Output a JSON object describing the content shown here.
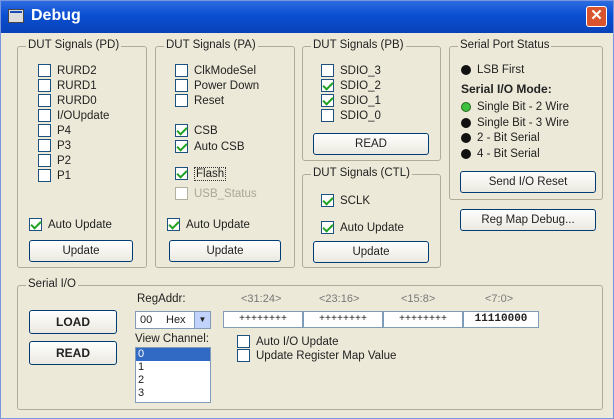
{
  "window": {
    "title": "Debug",
    "close_glyph": "✕"
  },
  "pd": {
    "title": "DUT Signals (PD)",
    "items": [
      {
        "label": "RURD2",
        "checked": false
      },
      {
        "label": "RURD1",
        "checked": false
      },
      {
        "label": "RURD0",
        "checked": false
      },
      {
        "label": "I/OUpdate",
        "checked": false
      },
      {
        "label": "P4",
        "checked": false
      },
      {
        "label": "P3",
        "checked": false
      },
      {
        "label": "P2",
        "checked": false
      },
      {
        "label": "P1",
        "checked": false
      }
    ],
    "auto_update": {
      "label": "Auto Update",
      "checked": true
    },
    "update_label": "Update"
  },
  "pa": {
    "title": "DUT Signals (PA)",
    "items": [
      {
        "label": "ClkModeSel",
        "checked": false
      },
      {
        "label": "Power Down",
        "checked": false
      },
      {
        "label": "Reset",
        "checked": false
      },
      {
        "label": "CSB",
        "checked": true
      },
      {
        "label": "Auto CSB",
        "checked": true
      },
      {
        "label": "Flash",
        "checked": true
      },
      {
        "label": "USB_Status",
        "checked": false,
        "disabled": true
      }
    ],
    "auto_update": {
      "label": "Auto Update",
      "checked": true
    },
    "update_label": "Update"
  },
  "pb": {
    "title": "DUT Signals (PB)",
    "items": [
      {
        "label": "SDIO_3",
        "checked": false
      },
      {
        "label": "SDIO_2",
        "checked": true
      },
      {
        "label": "SDIO_1",
        "checked": true
      },
      {
        "label": "SDIO_0",
        "checked": false
      }
    ],
    "read_label": "READ"
  },
  "ctl": {
    "title": "DUT Signals (CTL)",
    "sclk": {
      "label": "SCLK",
      "checked": true
    },
    "auto_update": {
      "label": "Auto Update",
      "checked": true
    },
    "update_label": "Update"
  },
  "sps": {
    "title": "Serial Port Status",
    "lsb_first": "LSB First",
    "mode_heading": "Serial I/O Mode:",
    "modes": [
      {
        "label": "Single Bit - 2 Wire",
        "selected": true
      },
      {
        "label": "Single Bit - 3 Wire",
        "selected": false
      },
      {
        "label": "2 - Bit Serial",
        "selected": false
      },
      {
        "label": "4 - Bit Serial",
        "selected": false
      }
    ],
    "send_reset_label": "Send I/O Reset"
  },
  "reg_map_debug_label": "Reg Map Debug...",
  "serial_io": {
    "title": "Serial I/O",
    "load_label": "LOAD",
    "read_label": "READ",
    "regaddr_label": "RegAddr:",
    "regaddr_value": "00",
    "regaddr_format": "Hex",
    "col_headers": [
      "<31:24>",
      "<23:16>",
      "<15:8>",
      "<7:0>"
    ],
    "hex_values": [
      "++++++++",
      "++++++++",
      "++++++++",
      "11110000"
    ],
    "view_channel_label": "View Channel:",
    "channels": [
      "0",
      "1",
      "2",
      "3"
    ],
    "selected_channel": "0",
    "auto_io_update": {
      "label": "Auto I/O Update",
      "checked": false
    },
    "update_register_map": {
      "label": "Update Register Map Value",
      "checked": false
    }
  },
  "colors": {
    "title_bar": "#0842b8",
    "window_bg": "#ece9d8",
    "selected_radio": "#3fbf3f",
    "list_selection": "#316ac5"
  }
}
